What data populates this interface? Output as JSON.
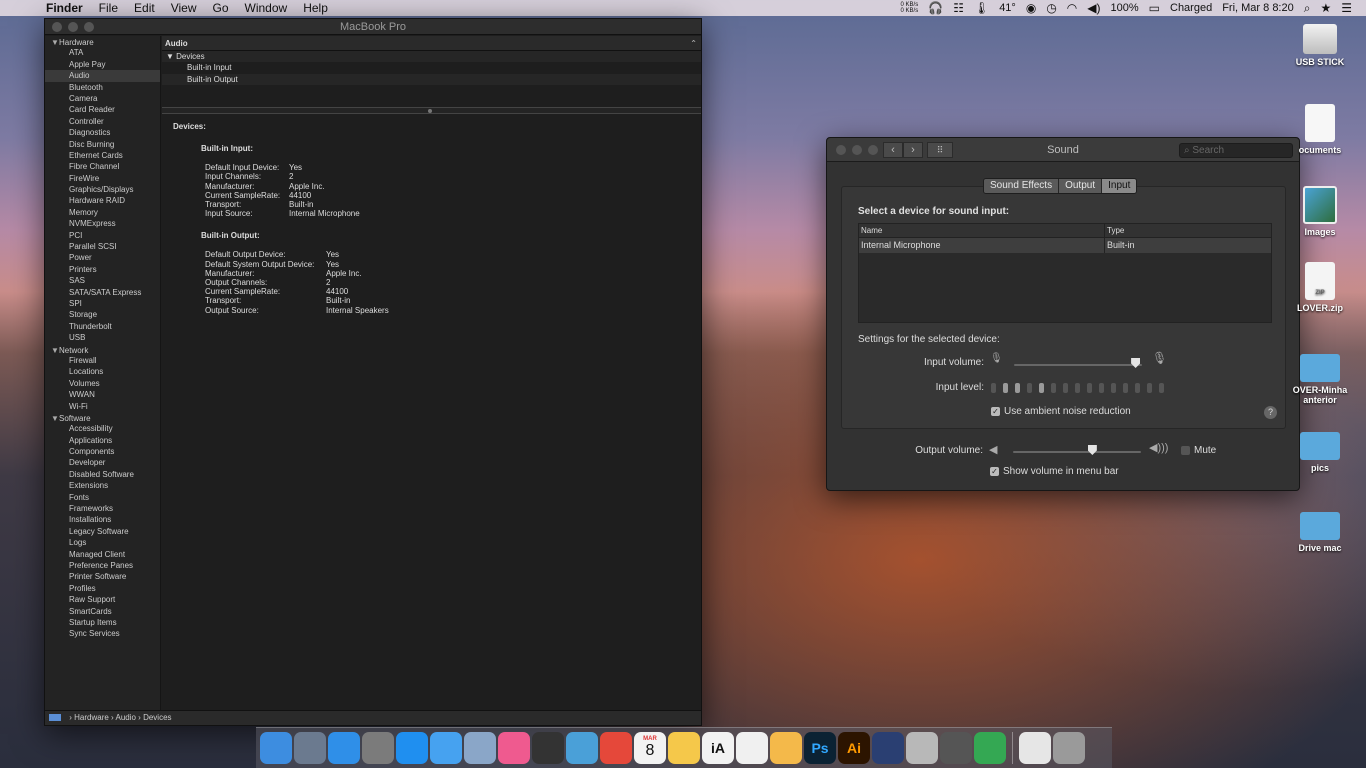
{
  "menubar": {
    "app_name": "Finder",
    "menus": [
      "File",
      "Edit",
      "View",
      "Go",
      "Window",
      "Help"
    ],
    "net_up": "0 KB/s",
    "net_down": "0 KB/s",
    "temperature": "41°",
    "battery_percent": "100%",
    "battery_status": "Charged",
    "clock": "Fri, Mar 8  8:20"
  },
  "sysinfo": {
    "title": "MacBook Pro",
    "sidebar": [
      {
        "group": "Hardware",
        "items": [
          "ATA",
          "Apple Pay",
          "Audio",
          "Bluetooth",
          "Camera",
          "Card Reader",
          "Controller",
          "Diagnostics",
          "Disc Burning",
          "Ethernet Cards",
          "Fibre Channel",
          "FireWire",
          "Graphics/Displays",
          "Hardware RAID",
          "Memory",
          "NVMExpress",
          "PCI",
          "Parallel SCSI",
          "Power",
          "Printers",
          "SAS",
          "SATA/SATA Express",
          "SPI",
          "Storage",
          "Thunderbolt",
          "USB"
        ]
      },
      {
        "group": "Network",
        "items": [
          "Firewall",
          "Locations",
          "Volumes",
          "WWAN",
          "Wi-Fi"
        ]
      },
      {
        "group": "Software",
        "items": [
          "Accessibility",
          "Applications",
          "Components",
          "Developer",
          "Disabled Software",
          "Extensions",
          "Fonts",
          "Frameworks",
          "Installations",
          "Legacy Software",
          "Logs",
          "Managed Client",
          "Preference Panes",
          "Printer Software",
          "Profiles",
          "Raw Support",
          "SmartCards",
          "Startup Items",
          "Sync Services"
        ]
      }
    ],
    "selected_item": "Audio",
    "detail_header": "Audio",
    "tree_root": "Devices",
    "tree_children": [
      "Built-in Input",
      "Built-in Output"
    ],
    "report_title": "Devices:",
    "input_heading": "Built-in Input:",
    "input_rows": [
      {
        "k": "Default Input Device:",
        "v": "Yes"
      },
      {
        "k": "Input Channels:",
        "v": "2"
      },
      {
        "k": "Manufacturer:",
        "v": "Apple Inc."
      },
      {
        "k": "Current SampleRate:",
        "v": "44100"
      },
      {
        "k": "Transport:",
        "v": "Built-in"
      },
      {
        "k": "Input Source:",
        "v": "Internal Microphone"
      }
    ],
    "output_heading": "Built-in Output:",
    "output_rows": [
      {
        "k": "Default Output Device:",
        "v": "Yes"
      },
      {
        "k": "Default System Output Device:",
        "v": "Yes"
      },
      {
        "k": "Manufacturer:",
        "v": "Apple Inc."
      },
      {
        "k": "Output Channels:",
        "v": "2"
      },
      {
        "k": "Current SampleRate:",
        "v": "44100"
      },
      {
        "k": "Transport:",
        "v": "Built-in"
      },
      {
        "k": "Output Source:",
        "v": "Internal Speakers"
      }
    ],
    "path": [
      "Hardware",
      "Audio",
      "Devices"
    ]
  },
  "sound": {
    "title": "Sound",
    "search_placeholder": "Search",
    "tabs": [
      "Sound Effects",
      "Output",
      "Input"
    ],
    "active_tab": "Input",
    "heading": "Select a device for sound input:",
    "columns": [
      "Name",
      "Type"
    ],
    "devices": [
      {
        "name": "Internal Microphone",
        "type": "Built-in"
      }
    ],
    "settings_label": "Settings for the selected device:",
    "input_volume_label": "Input volume:",
    "input_volume_fraction": 0.95,
    "input_level_label": "Input level:",
    "input_level_segments": 15,
    "input_level_active": [
      1,
      2,
      4
    ],
    "noise_reduction_label": "Use ambient noise reduction",
    "noise_reduction_checked": true,
    "output_volume_label": "Output volume:",
    "output_volume_fraction": 0.62,
    "mute_label": "Mute",
    "mute_checked": false,
    "show_volume_label": "Show volume in menu bar",
    "show_volume_checked": true,
    "help": "?"
  },
  "desktop": [
    {
      "label": "USB STICK",
      "kind": "drive"
    },
    {
      "label": "ocuments",
      "kind": "doc"
    },
    {
      "label": "Images",
      "kind": "img"
    },
    {
      "label": "LOVER.zip",
      "kind": "zip",
      "badge": "ZIP"
    },
    {
      "label": "OVER-Minha anterior",
      "kind": "folder"
    },
    {
      "label": "pics",
      "kind": "folder"
    },
    {
      "label": "Drive mac",
      "kind": "folder"
    }
  ],
  "dock": [
    {
      "name": "finder",
      "color": "#3d8de0"
    },
    {
      "name": "launchpad",
      "color": "#6b7a8f"
    },
    {
      "name": "safari",
      "color": "#2f8fe8"
    },
    {
      "name": "system-preferences",
      "color": "#7b7b7b"
    },
    {
      "name": "app-store",
      "color": "#1f8ff0"
    },
    {
      "name": "messages",
      "color": "#46a2f0"
    },
    {
      "name": "preview",
      "color": "#8aa6c8"
    },
    {
      "name": "itunes",
      "color": "#ef5a8f"
    },
    {
      "name": "headphones",
      "color": "#333333"
    },
    {
      "name": "mustache",
      "color": "#4aa0d8"
    },
    {
      "name": "chrome",
      "color": "#e5483a"
    },
    {
      "name": "calendar",
      "color": "#f2f2f2",
      "month": "MAR",
      "day": "8"
    },
    {
      "name": "notes",
      "color": "#f5c84a"
    },
    {
      "name": "ia-writer",
      "color": "#f2f2f2",
      "text": "iA"
    },
    {
      "name": "photos",
      "color": "#f0f0f0"
    },
    {
      "name": "sketch-app",
      "color": "#f4b94a"
    },
    {
      "name": "photoshop",
      "color": "#0b2233",
      "text": "Ps"
    },
    {
      "name": "illustrator",
      "color": "#2c1400",
      "text": "Ai"
    },
    {
      "name": "battlenet",
      "color": "#2a3f72"
    },
    {
      "name": "archive",
      "color": "#b8b8b8"
    },
    {
      "name": "network",
      "color": "#555555"
    },
    {
      "name": "green-app",
      "color": "#34a853"
    },
    {
      "name": "music-folder",
      "color": "#e6e6e6"
    },
    {
      "name": "trash",
      "color": "#9a9a9a"
    }
  ]
}
